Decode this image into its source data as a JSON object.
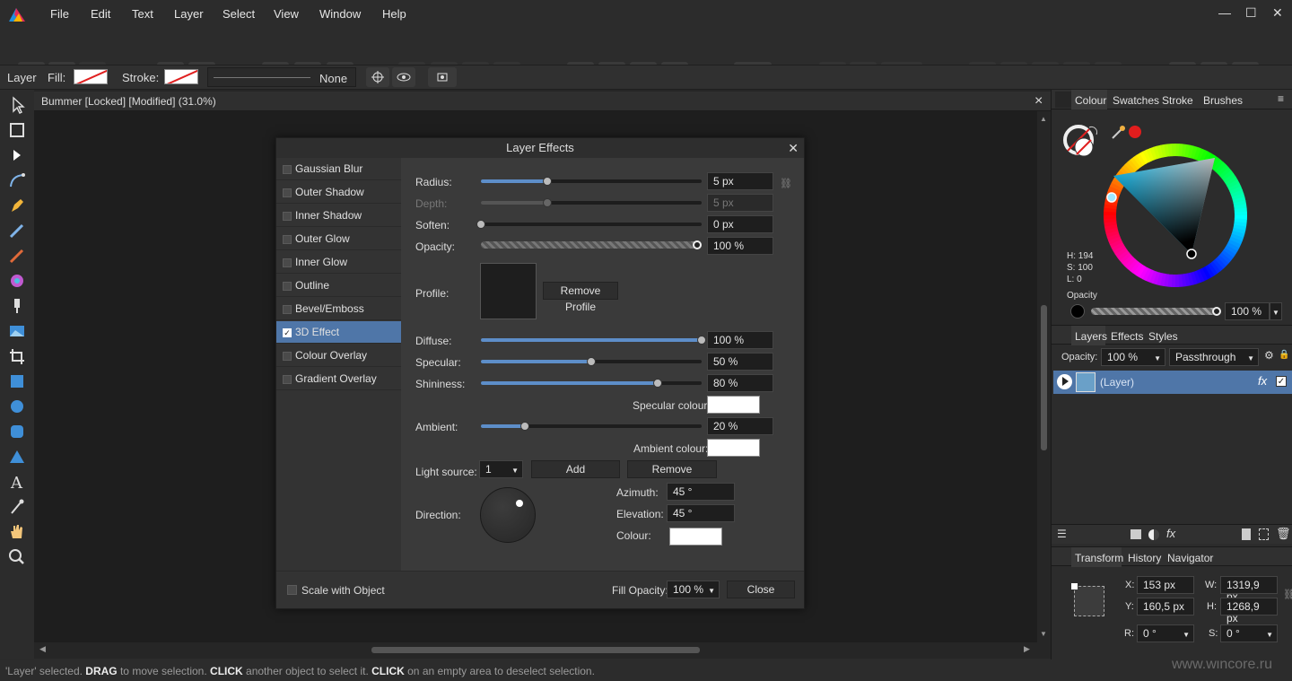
{
  "menu": [
    "File",
    "Edit",
    "Text",
    "Layer",
    "Select",
    "View",
    "Window",
    "Help"
  ],
  "window_controls": {
    "minimize": "—",
    "maximize": "☐",
    "close": "✕"
  },
  "context_toolbar": {
    "layer_label": "Layer",
    "fill_label": "Fill:",
    "stroke_label": "Stroke:",
    "stroke_style": "None"
  },
  "document": {
    "tab_title": "Bummer [Locked] [Modified] (31.0%)",
    "close": "×"
  },
  "status_bar": {
    "parts": [
      "'Layer' selected. ",
      "DRAG",
      " to move selection. ",
      "CLICK",
      " another object to select it. ",
      "CLICK",
      " on an empty area to deselect selection."
    ],
    "watermark": "www.wincore.ru"
  },
  "colour_panel": {
    "tabs": [
      "Colour",
      "Swatches",
      "Stroke",
      "Brushes"
    ],
    "h": "H: 194",
    "s": "S: 100",
    "l": "L: 0",
    "opacity_label": "Opacity",
    "opacity_value": "100 %",
    "hue_value": 194,
    "accent_dot": "#e11d1d"
  },
  "layers_panel": {
    "tabs": [
      "Layers",
      "Effects",
      "Styles"
    ],
    "opacity_label": "Opacity:",
    "opacity_value": "100 %",
    "blend_mode": "Passthrough",
    "layer_name": "(Layer)",
    "selected_color": "#4f76a8"
  },
  "transform_panel": {
    "tabs": [
      "Transform",
      "History",
      "Navigator"
    ],
    "x_label": "X:",
    "x_value": "153 px",
    "y_label": "Y:",
    "y_value": "160,5 px",
    "w_label": "W:",
    "w_value": "1319,9 px",
    "h_label": "H:",
    "h_value": "1268,9 px",
    "r_label": "R:",
    "r_value": "0 °",
    "s_label": "S:",
    "s_value": "0 °"
  },
  "dialog": {
    "title": "Layer Effects",
    "close": "✕",
    "effects": [
      {
        "label": "Gaussian Blur",
        "checked": false
      },
      {
        "label": "Outer Shadow",
        "checked": false
      },
      {
        "label": "Inner Shadow",
        "checked": false
      },
      {
        "label": "Outer Glow",
        "checked": false
      },
      {
        "label": "Inner Glow",
        "checked": false
      },
      {
        "label": "Outline",
        "checked": false
      },
      {
        "label": "Bevel/Emboss",
        "checked": false
      },
      {
        "label": "3D Effect",
        "checked": true
      },
      {
        "label": "Colour Overlay",
        "checked": false
      },
      {
        "label": "Gradient Overlay",
        "checked": false
      }
    ],
    "radius": {
      "label": "Radius:",
      "value": "5 px",
      "level": 0.3
    },
    "depth": {
      "label": "Depth:",
      "value": "5 px",
      "level": 0.3
    },
    "soften": {
      "label": "Soften:",
      "value": "0 px",
      "level": 0.0
    },
    "opacity": {
      "label": "Opacity:",
      "value": "100 %",
      "level": 1.0
    },
    "profile": {
      "label": "Profile:",
      "remove_button": "Remove Profile"
    },
    "diffuse": {
      "label": "Diffuse:",
      "value": "100 %",
      "level": 1.0
    },
    "specular": {
      "label": "Specular:",
      "value": "50 %",
      "level": 0.5
    },
    "shininess": {
      "label": "Shininess:",
      "value": "80 %",
      "level": 0.8
    },
    "specular_colour_label": "Specular colour:",
    "ambient": {
      "label": "Ambient:",
      "value": "20 %",
      "level": 0.2
    },
    "ambient_colour_label": "Ambient colour:",
    "light_source": {
      "label": "Light source:",
      "value": "1",
      "add": "Add",
      "remove": "Remove"
    },
    "direction_label": "Direction:",
    "azimuth": {
      "label": "Azimuth:",
      "value": "45 °"
    },
    "elevation": {
      "label": "Elevation:",
      "value": "45 °"
    },
    "colour_label": "Colour:",
    "scale_with_object": "Scale with Object",
    "fill_opacity": {
      "label": "Fill Opacity:",
      "value": "100 %"
    },
    "close_button": "Close"
  }
}
